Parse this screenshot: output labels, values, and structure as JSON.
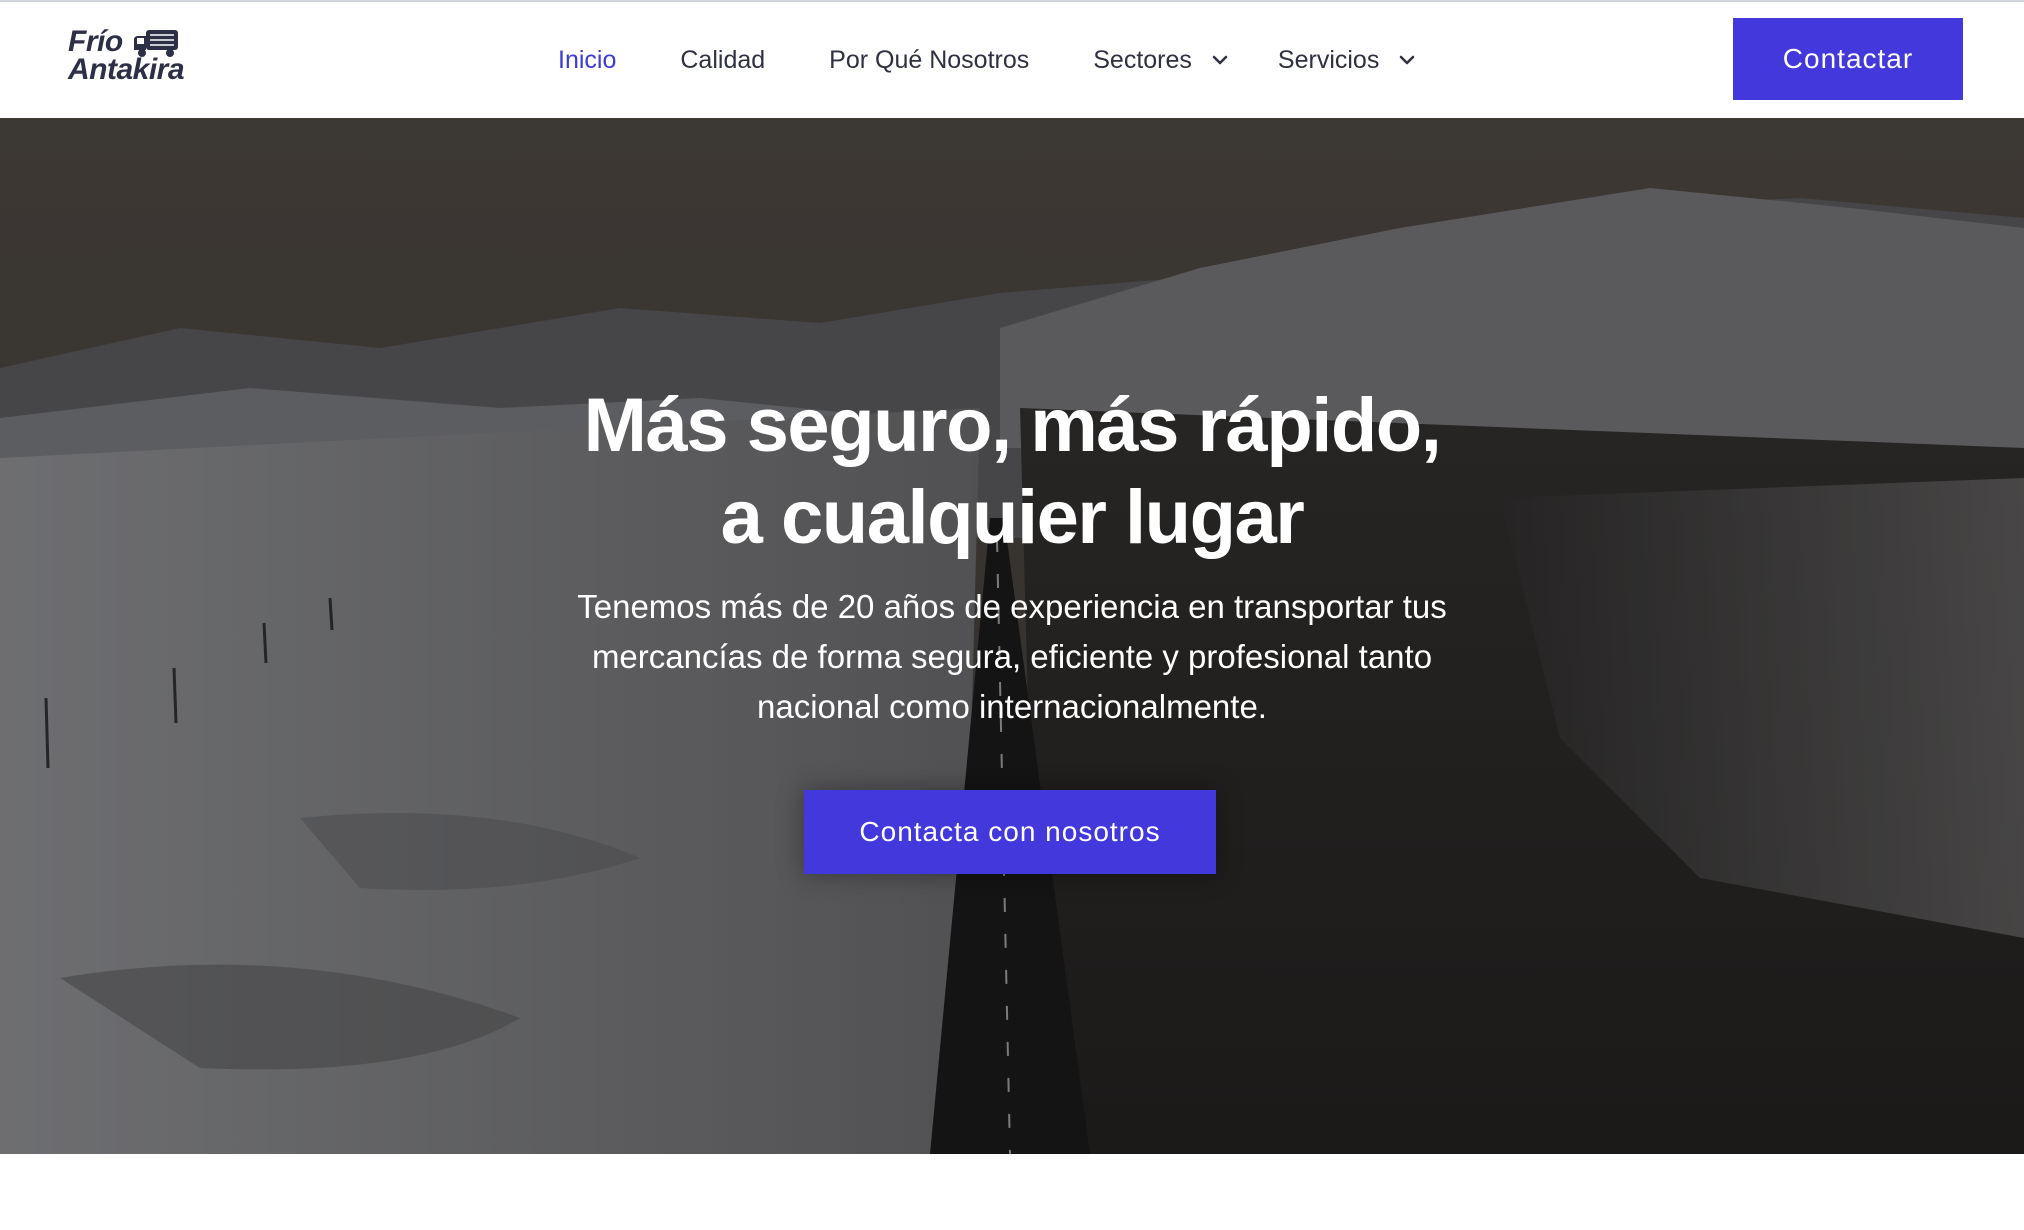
{
  "brand": {
    "logo_line1": "Frío",
    "logo_line2": "Antakira",
    "logo_icon": "truck-icon"
  },
  "nav": {
    "items": [
      {
        "label": "Inicio",
        "active": true
      },
      {
        "label": "Calidad"
      },
      {
        "label": "Por Qué Nosotros"
      },
      {
        "label": "Sectores",
        "icon": "chevron-down-icon"
      },
      {
        "label": "Servicios",
        "icon": "chevron-down-icon"
      }
    ],
    "cta_label": "Contactar"
  },
  "hero": {
    "title_line1": "Más seguro, más rápido,",
    "title_line2": "a cualquier lugar",
    "subtitle": "Tenemos más de 20 años de experiencia en transportar tus mercancías de forma segura, eficiente y profesional tanto nacional como internacionalmente.",
    "cta_label": "Contacta con nosotros"
  },
  "colors": {
    "accent": "#4338db",
    "active_link": "#3d3bd4",
    "text_dark": "#2f3142"
  }
}
